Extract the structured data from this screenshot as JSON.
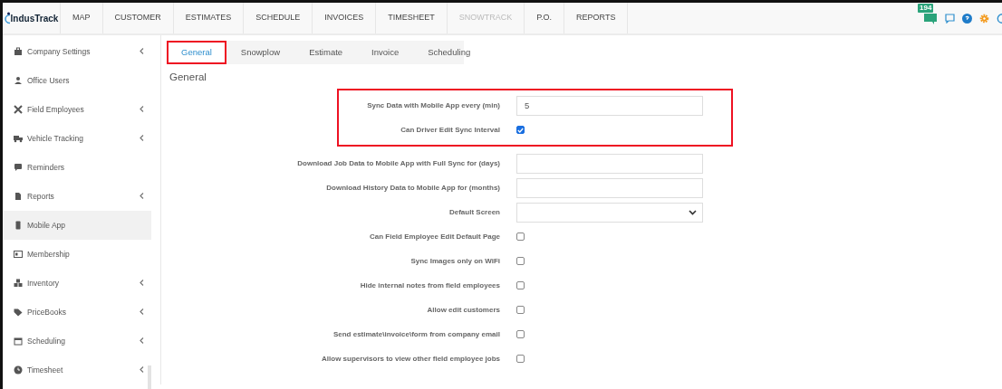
{
  "navbar": {
    "logo": "IndusTrack",
    "items": [
      {
        "label": "MAP",
        "disabled": false
      },
      {
        "label": "CUSTOMER",
        "disabled": false
      },
      {
        "label": "ESTIMATES",
        "disabled": false
      },
      {
        "label": "SCHEDULE",
        "disabled": false
      },
      {
        "label": "INVOICES",
        "disabled": false
      },
      {
        "label": "TIMESHEET",
        "disabled": false
      },
      {
        "label": "SNOWTRACK",
        "disabled": true
      },
      {
        "label": "P.O.",
        "disabled": false
      },
      {
        "label": "REPORTS",
        "disabled": false
      }
    ],
    "notification_count": "194"
  },
  "sidebar": {
    "items": [
      {
        "label": "Company Settings",
        "has_submenu": true,
        "selected": false
      },
      {
        "label": "Office Users",
        "has_submenu": false,
        "selected": false
      },
      {
        "label": "Field Employees",
        "has_submenu": true,
        "selected": false
      },
      {
        "label": "Vehicle Tracking",
        "has_submenu": true,
        "selected": false
      },
      {
        "label": "Reminders",
        "has_submenu": false,
        "selected": false
      },
      {
        "label": "Reports",
        "has_submenu": true,
        "selected": false
      },
      {
        "label": "Mobile App",
        "has_submenu": false,
        "selected": true
      },
      {
        "label": "Membership",
        "has_submenu": false,
        "selected": false
      },
      {
        "label": "Inventory",
        "has_submenu": true,
        "selected": false
      },
      {
        "label": "PriceBooks",
        "has_submenu": true,
        "selected": false
      },
      {
        "label": "Scheduling",
        "has_submenu": true,
        "selected": false
      },
      {
        "label": "Timesheet",
        "has_submenu": true,
        "selected": false
      }
    ]
  },
  "tabs": [
    {
      "label": "General",
      "selected": true,
      "highlighted": true
    },
    {
      "label": "Snowplow",
      "selected": false,
      "highlighted": false
    },
    {
      "label": "Estimate",
      "selected": false,
      "highlighted": false
    },
    {
      "label": "Invoice",
      "selected": false,
      "highlighted": false
    },
    {
      "label": "Scheduling",
      "selected": false,
      "highlighted": false
    }
  ],
  "section_title": "General",
  "form": {
    "highlighted_fields": [
      {
        "kind": "input",
        "label": "Sync Data with Mobile App every (min)",
        "value": "5"
      },
      {
        "kind": "checkbox",
        "label": "Can Driver Edit Sync Interval",
        "checked": true
      }
    ],
    "fields": [
      {
        "kind": "input",
        "label": "Download Job Data to Mobile App with Full Sync for (days)"
      },
      {
        "kind": "input",
        "label": "Download History Data to Mobile App for (months)"
      },
      {
        "kind": "select",
        "label": "Default Screen"
      },
      {
        "kind": "checkbox",
        "label": "Can Field Employee Edit Default Page",
        "checked": false
      },
      {
        "kind": "checkbox",
        "label": "Sync Images only on WiFi",
        "checked": false
      },
      {
        "kind": "checkbox",
        "label": "Hide internal notes from field employees",
        "checked": false
      },
      {
        "kind": "checkbox",
        "label": "Allow edit customers",
        "checked": false
      },
      {
        "kind": "checkbox",
        "label": "Send estimate\\invoice\\form from company email",
        "checked": false
      },
      {
        "kind": "checkbox",
        "label": "Allow supervisors to view other field employee jobs",
        "checked": false
      }
    ]
  }
}
